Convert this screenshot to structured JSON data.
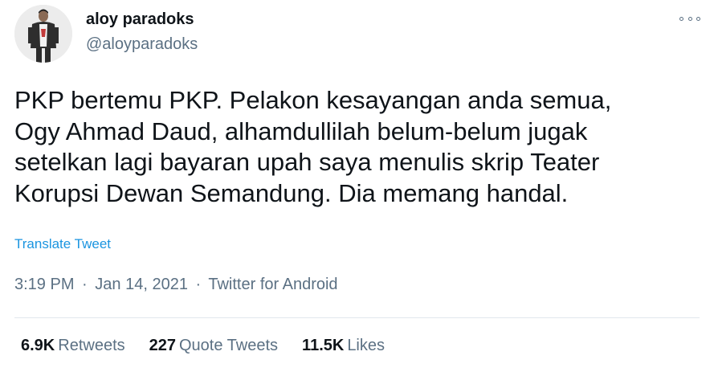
{
  "author": {
    "name": "aloy paradoks",
    "handle": "@aloyparadoks"
  },
  "icons": {
    "avatar": "profile-photo",
    "more": "more-horizontal-icon"
  },
  "tweet": {
    "lines": [
      "PKP bertemu PKP. Pelakon kesayangan anda semua,",
      "Ogy Ahmad Daud, alhamdullilah belum-belum jugak",
      "setelkan lagi bayaran upah saya menulis skrip Teater",
      "Korupsi Dewan Semandung. Dia memang handal."
    ],
    "translate_label": "Translate Tweet"
  },
  "meta": {
    "time": "3:19 PM",
    "separator": "·",
    "date": "Jan 14, 2021",
    "source": "Twitter for Android"
  },
  "stats": {
    "retweets_count": "6.9K",
    "retweets_label": "Retweets",
    "quotes_count": "227",
    "quotes_label": "Quote Tweets",
    "likes_count": "11.5K",
    "likes_label": "Likes"
  },
  "colors": {
    "text": "#0f1419",
    "secondary": "#5b7083",
    "link": "#1b95e0",
    "divider": "#e1e8ed"
  }
}
